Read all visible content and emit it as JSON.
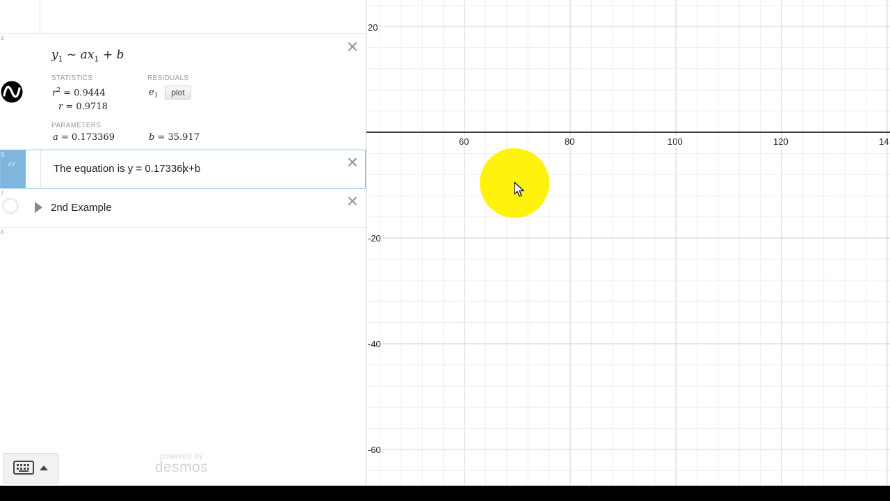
{
  "expressions": [
    {
      "num": "4",
      "regression": {
        "formula": {
          "y": "y",
          "y_sub": "1",
          "tilde": "~",
          "a": "a",
          "x": "x",
          "x_sub": "1",
          "plus": "+",
          "b": "b"
        },
        "statistics_label": "STATISTICS",
        "residuals_label": "RESIDUALS",
        "r2": {
          "sym": "r",
          "exp": "2",
          "eq": "= 0.9444"
        },
        "r": {
          "sym": "r",
          "eq": "= 0.9718"
        },
        "residual": {
          "sym": "e",
          "sub": "1"
        },
        "plot_label": "plot",
        "parameters_label": "PARAMETERS",
        "a": {
          "sym": "a",
          "eq": "= 0.173369"
        },
        "b": {
          "sym": "b",
          "eq": "= 35.917"
        }
      }
    },
    {
      "num": "5",
      "note_text_before_cursor": "The equation is y = 0.17336",
      "note_text_after_cursor": "x+b"
    },
    {
      "num": "7",
      "folder_title": "2nd Example"
    },
    {
      "num": "8"
    }
  ],
  "close_symbol": "✕",
  "powered_by": {
    "line1": "powered by",
    "line2": "desmos"
  },
  "graph": {
    "x_ticks": [
      "60",
      "80",
      "100",
      "120",
      "14"
    ],
    "y_ticks": [
      "20",
      "-20",
      "-40",
      "-60"
    ]
  },
  "icons": {
    "desmos_logo": "desmos-logo-icon",
    "keyboard": "keyboard-icon",
    "caret_up": "caret-up-icon",
    "note": "quote-icon",
    "folder_toggle": "triangle-right-icon",
    "cursor": "mouse-cursor-icon"
  },
  "colors": {
    "selected_tab": "#7fb6dd",
    "selected_border": "#8cc3e4",
    "highlight": "#fff200",
    "axis": "#000000",
    "grid_major": "#d0d0d0",
    "grid_minor": "#ededed"
  }
}
